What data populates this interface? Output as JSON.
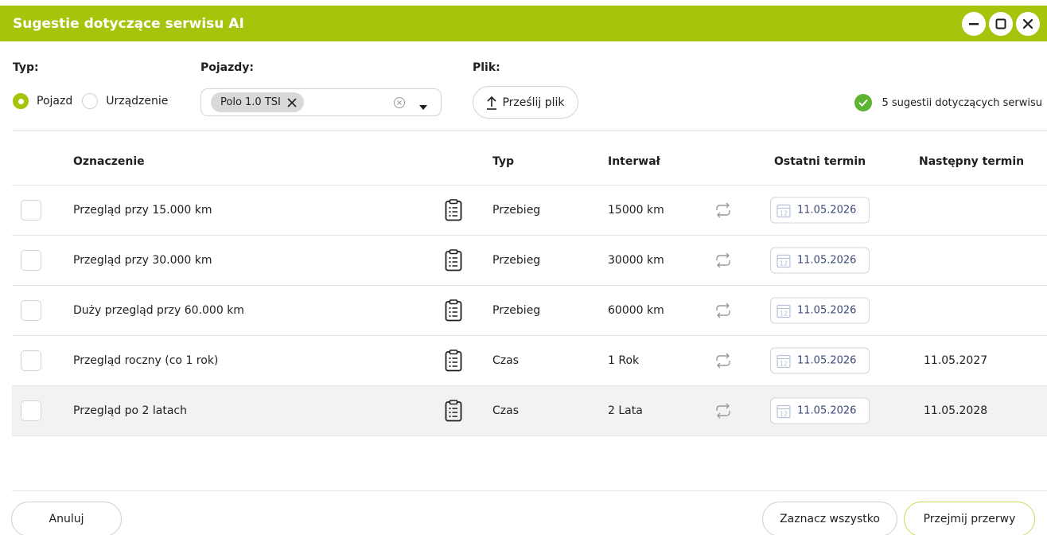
{
  "window": {
    "title": "Sugestie dotyczące serwisu AI"
  },
  "filters": {
    "type_label": "Typ:",
    "vehicles_label": "Pojazdy:",
    "file_label": "Plik:",
    "type_options": [
      {
        "label": "Pojazd",
        "checked": true
      },
      {
        "label": "Urządzenie",
        "checked": false
      }
    ],
    "selected_vehicle": "Polo 1.0 TSI",
    "upload_label": "Prześlij plik"
  },
  "status": {
    "text": "5 sugestii dotyczących serwisu",
    "color": "#5cb432"
  },
  "table": {
    "headers": {
      "designation": "Oznaczenie",
      "type": "Typ",
      "interval": "Interwał",
      "last_date": "Ostatni termin",
      "next_date": "Następny termin"
    },
    "rows": [
      {
        "name": "Przegląd przy 15.000 km",
        "type": "Przebieg",
        "interval": "15000 km",
        "last": "11.05.2026",
        "next": ""
      },
      {
        "name": "Przegląd przy 30.000 km",
        "type": "Przebieg",
        "interval": "30000 km",
        "last": "11.05.2026",
        "next": ""
      },
      {
        "name": "Duży przegląd przy 60.000 km",
        "type": "Przebieg",
        "interval": "60000 km",
        "last": "11.05.2026",
        "next": ""
      },
      {
        "name": "Przegląd roczny (co 1 rok)",
        "type": "Czas",
        "interval": "1 Rok",
        "last": "11.05.2026",
        "next": "11.05.2027"
      },
      {
        "name": "Przegląd po 2 latach",
        "type": "Czas",
        "interval": "2 Lata",
        "last": "11.05.2026",
        "next": "11.05.2028"
      }
    ]
  },
  "footer": {
    "cancel": "Anuluj",
    "select_all": "Zaznacz wszystko",
    "accept": "Przejmij przerwy"
  },
  "colors": {
    "accent": "#a8c30c",
    "date_text": "#3b4a7a"
  },
  "icons": {
    "minimize": "minimize-icon",
    "maximize": "maximize-icon",
    "close": "close-icon",
    "chip_remove": "close-icon",
    "clear": "clear-circle-icon",
    "dropdown": "caret-down-icon",
    "upload": "upload-arrow-icon",
    "status": "check-circle-icon",
    "row_detail": "clipboard-list-icon",
    "repeat": "repeat-icon",
    "date": "calendar-icon"
  }
}
